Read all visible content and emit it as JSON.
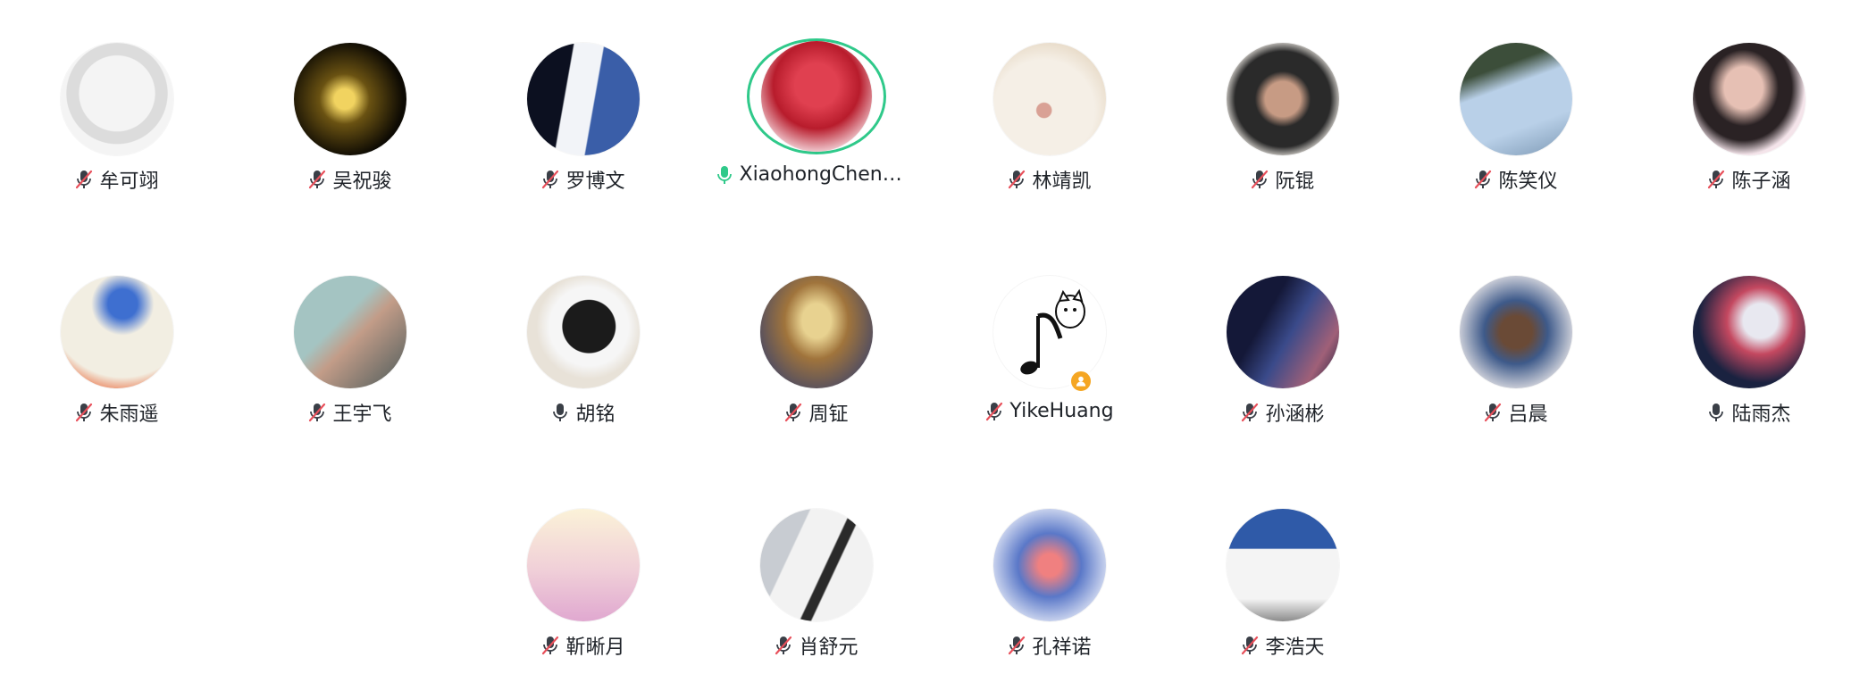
{
  "participants": [
    {
      "name": "牟可翊",
      "mic": "muted",
      "speaking": false,
      "avatar": "cartoon-sketch",
      "colors": [
        "#f4f4f4",
        "#dcdcdc",
        "#9a9a9a"
      ]
    },
    {
      "name": "吴祝骏",
      "mic": "muted",
      "speaking": false,
      "avatar": "night-landscape",
      "colors": [
        "#0d0a03",
        "#6a5212",
        "#f1d360"
      ]
    },
    {
      "name": "罗博文",
      "mic": "muted",
      "speaking": false,
      "avatar": "suit-and-building",
      "colors": [
        "#0c1020",
        "#f2f4f8",
        "#3a5ea8"
      ]
    },
    {
      "name": "XiaohongChen@...",
      "mic": "speaking",
      "speaking": true,
      "avatar": "flower-bouquet",
      "colors": [
        "#b81c2c",
        "#e04050",
        "#f6dbe0"
      ]
    },
    {
      "name": "林靖凯",
      "mic": "muted",
      "speaking": false,
      "avatar": "white-puppy",
      "colors": [
        "#f5efe6",
        "#e6d8c4",
        "#d9a195"
      ]
    },
    {
      "name": "阮锟",
      "mic": "muted",
      "speaking": false,
      "avatar": "girl-portrait",
      "colors": [
        "#ece8e2",
        "#2a2a2a",
        "#c79b84"
      ]
    },
    {
      "name": "陈笑仪",
      "mic": "muted",
      "speaking": false,
      "avatar": "sky-and-trees",
      "colors": [
        "#b9d0e8",
        "#7c98b4",
        "#3c4e3a"
      ]
    },
    {
      "name": "陈子涵",
      "mic": "muted",
      "speaking": false,
      "avatar": "selfie-portrait",
      "colors": [
        "#f4e4ea",
        "#2a2224",
        "#e6c0b4"
      ]
    },
    {
      "name": "朱雨遥",
      "mic": "muted",
      "speaking": false,
      "avatar": "anime-character",
      "colors": [
        "#f2eee2",
        "#3e6fd0",
        "#e86030"
      ]
    },
    {
      "name": "王宇飞",
      "mic": "muted",
      "speaking": false,
      "avatar": "dancing-figure",
      "colors": [
        "#a4c4c2",
        "#c29c88",
        "#4a5a5a"
      ]
    },
    {
      "name": "胡铭",
      "mic": "on",
      "speaking": false,
      "avatar": "black-white-cat",
      "colors": [
        "#e8e2d8",
        "#1b1b1b",
        "#f6f6f6"
      ]
    },
    {
      "name": "周钲",
      "mic": "muted",
      "speaking": false,
      "avatar": "armored-knight",
      "colors": [
        "#a0743c",
        "#e8d290",
        "#4a4a64"
      ]
    },
    {
      "name": "YikeHuang",
      "mic": "muted",
      "speaking": false,
      "avatar": "music-note-cat",
      "colors": [
        "#ffffff",
        "#1a1a1a",
        "#f5a623"
      ],
      "badge": "user-badge-icon"
    },
    {
      "name": "孙涵彬",
      "mic": "muted",
      "speaking": false,
      "avatar": "dark-anime",
      "colors": [
        "#141838",
        "#3a4a8a",
        "#a06078"
      ]
    },
    {
      "name": "吕晨",
      "mic": "muted",
      "speaking": false,
      "avatar": "game-character",
      "colors": [
        "#c4c8d4",
        "#3e5a8a",
        "#6a4a36"
      ]
    },
    {
      "name": "陆雨杰",
      "mic": "on",
      "speaking": false,
      "avatar": "shark-art",
      "colors": [
        "#1a2240",
        "#c44860",
        "#e8e8f0"
      ]
    },
    {
      "name": "靳晰月",
      "mic": "muted",
      "speaking": false,
      "avatar": "pastel-gradient",
      "colors": [
        "#fbf2d8",
        "#f0cfd8",
        "#e0a8d0"
      ]
    },
    {
      "name": "肖舒元",
      "mic": "muted",
      "speaking": false,
      "avatar": "guitar-closeup",
      "colors": [
        "#c8ccd2",
        "#f2f2f2",
        "#2a2a2a"
      ]
    },
    {
      "name": "孔祥诺",
      "mic": "muted",
      "speaking": false,
      "avatar": "sunset-art",
      "colors": [
        "#5a78c8",
        "#f08080",
        "#e8ecf8"
      ]
    },
    {
      "name": "李浩天",
      "mic": "muted",
      "speaking": false,
      "avatar": "cat-with-hat",
      "colors": [
        "#2f5aa8",
        "#f4f4f4",
        "#8c8c8c"
      ]
    }
  ]
}
